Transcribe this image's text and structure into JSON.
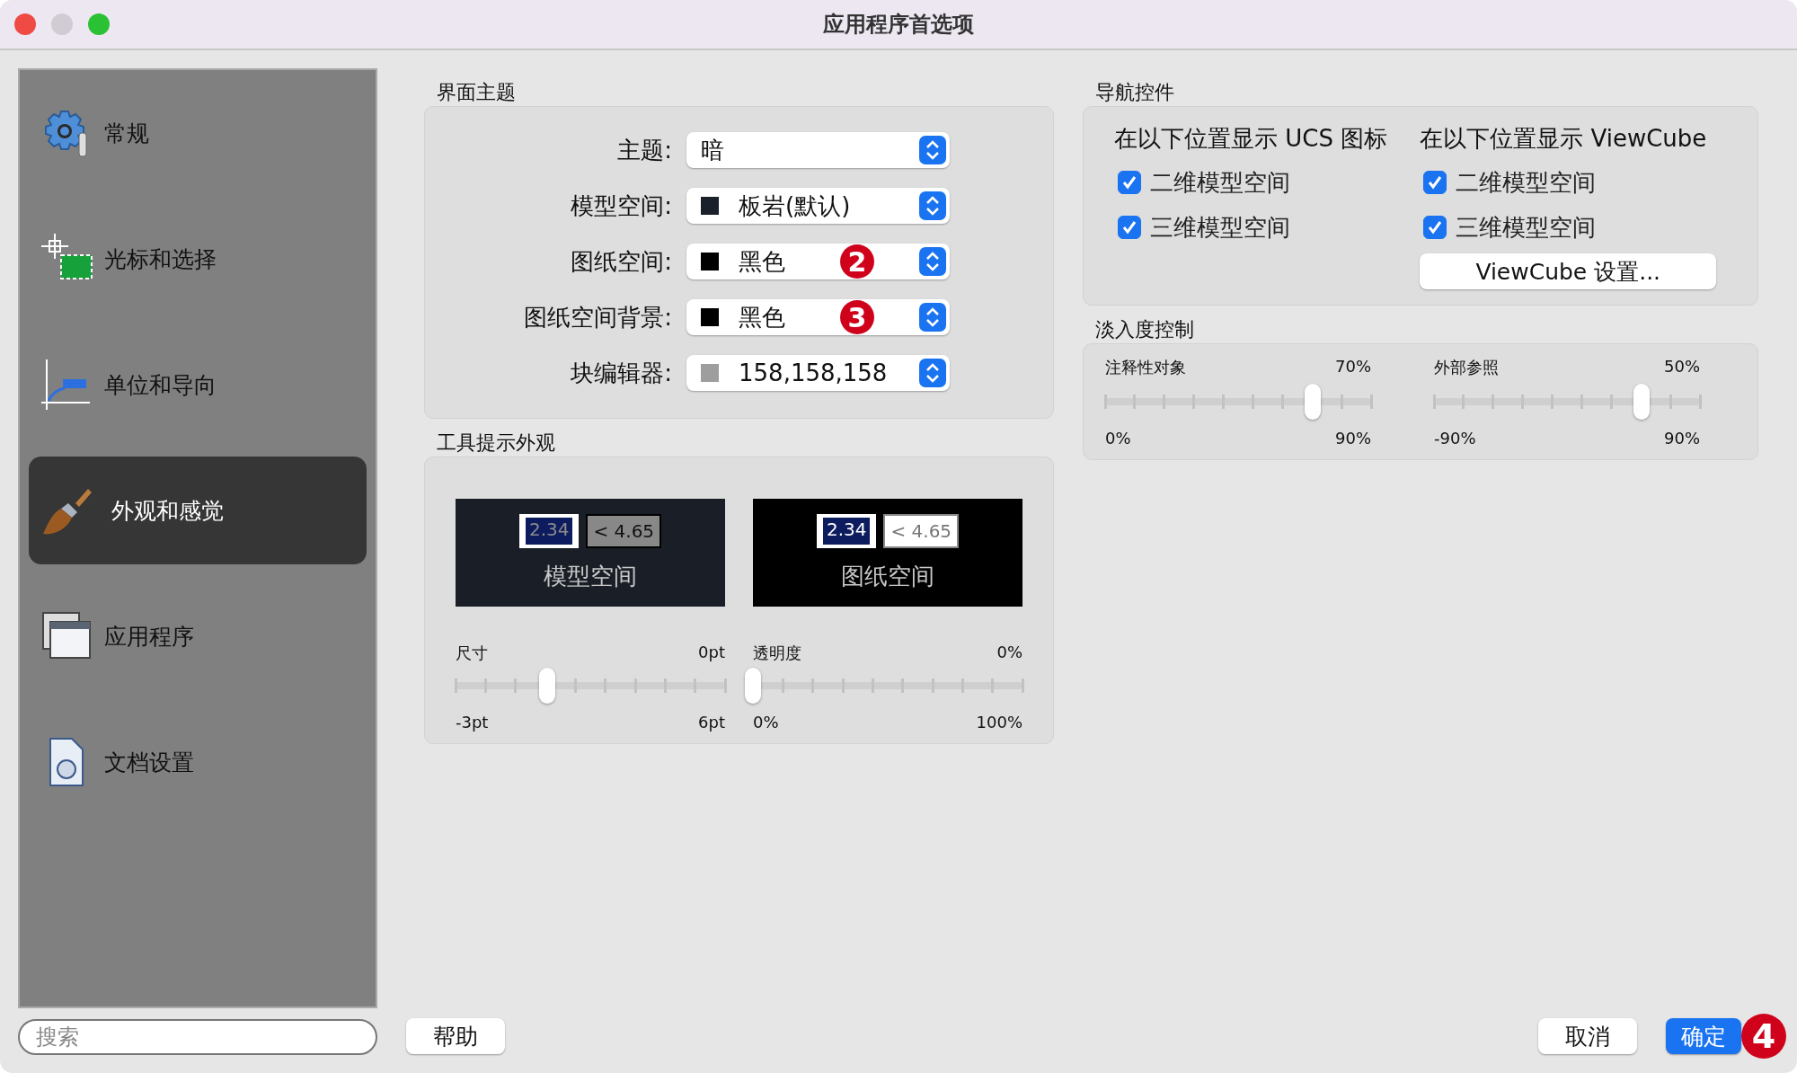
{
  "window": {
    "title": "应用程序首选项"
  },
  "sidebar": {
    "items": [
      {
        "label": "常规",
        "selected": false
      },
      {
        "label": "光标和选择",
        "selected": false
      },
      {
        "label": "单位和导向",
        "selected": false
      },
      {
        "label": "外观和感觉",
        "selected": true
      },
      {
        "label": "应用程序",
        "selected": false
      },
      {
        "label": "文档设置",
        "selected": false
      }
    ],
    "search": {
      "placeholder": "搜索"
    }
  },
  "theme_group": {
    "title": "界面主题",
    "rows": [
      {
        "label": "主题:",
        "value": "暗"
      },
      {
        "label": "模型空间:",
        "value": "板岩(默认)",
        "color": "#1b212b"
      },
      {
        "label": "图纸空间:",
        "value": "黑色",
        "color": "#000000",
        "callout": "2"
      },
      {
        "label": "图纸空间背景:",
        "value": "黑色",
        "color": "#000000",
        "callout": "3"
      },
      {
        "label": "块编辑器:",
        "value": "158,158,158",
        "color": "#9e9e9e"
      }
    ]
  },
  "tooltip_group": {
    "title": "工具提示外观",
    "previews": [
      {
        "kind": "model",
        "value": "2.34",
        "hint": "< 4.65",
        "caption": "模型空间"
      },
      {
        "kind": "paper",
        "value": "2.34",
        "hint": "< 4.65",
        "caption": "图纸空间"
      }
    ],
    "sliders": [
      {
        "label": "尺寸",
        "reading": "0pt",
        "min": "-3pt",
        "max": "6pt",
        "level": 0.34
      },
      {
        "label": "透明度",
        "reading": "0%",
        "min": "0%",
        "max": "100%",
        "level": 0
      }
    ]
  },
  "navigation_group": {
    "title": "导航控件",
    "columns": [
      {
        "heading": "在以下位置显示 UCS 图标",
        "options": [
          {
            "label": "二维模型空间",
            "checked": true
          },
          {
            "label": "三维模型空间",
            "checked": true
          }
        ]
      },
      {
        "heading": "在以下位置显示 ViewCube",
        "options": [
          {
            "label": "二维模型空间",
            "checked": true
          },
          {
            "label": "三维模型空间",
            "checked": true
          }
        ],
        "button": "ViewCube 设置..."
      }
    ]
  },
  "fade_group": {
    "title": "淡入度控制",
    "sliders": [
      {
        "label": "注释性对象",
        "reading": "70%",
        "min": "0%",
        "max": "90%",
        "level": 0.78
      },
      {
        "label": "外部参照",
        "reading": "50%",
        "min": "-90%",
        "max": "90%",
        "level": 0.78
      }
    ]
  },
  "buttons": {
    "help": "帮助",
    "cancel": "取消",
    "ok": "确定",
    "ok_callout": "4"
  }
}
